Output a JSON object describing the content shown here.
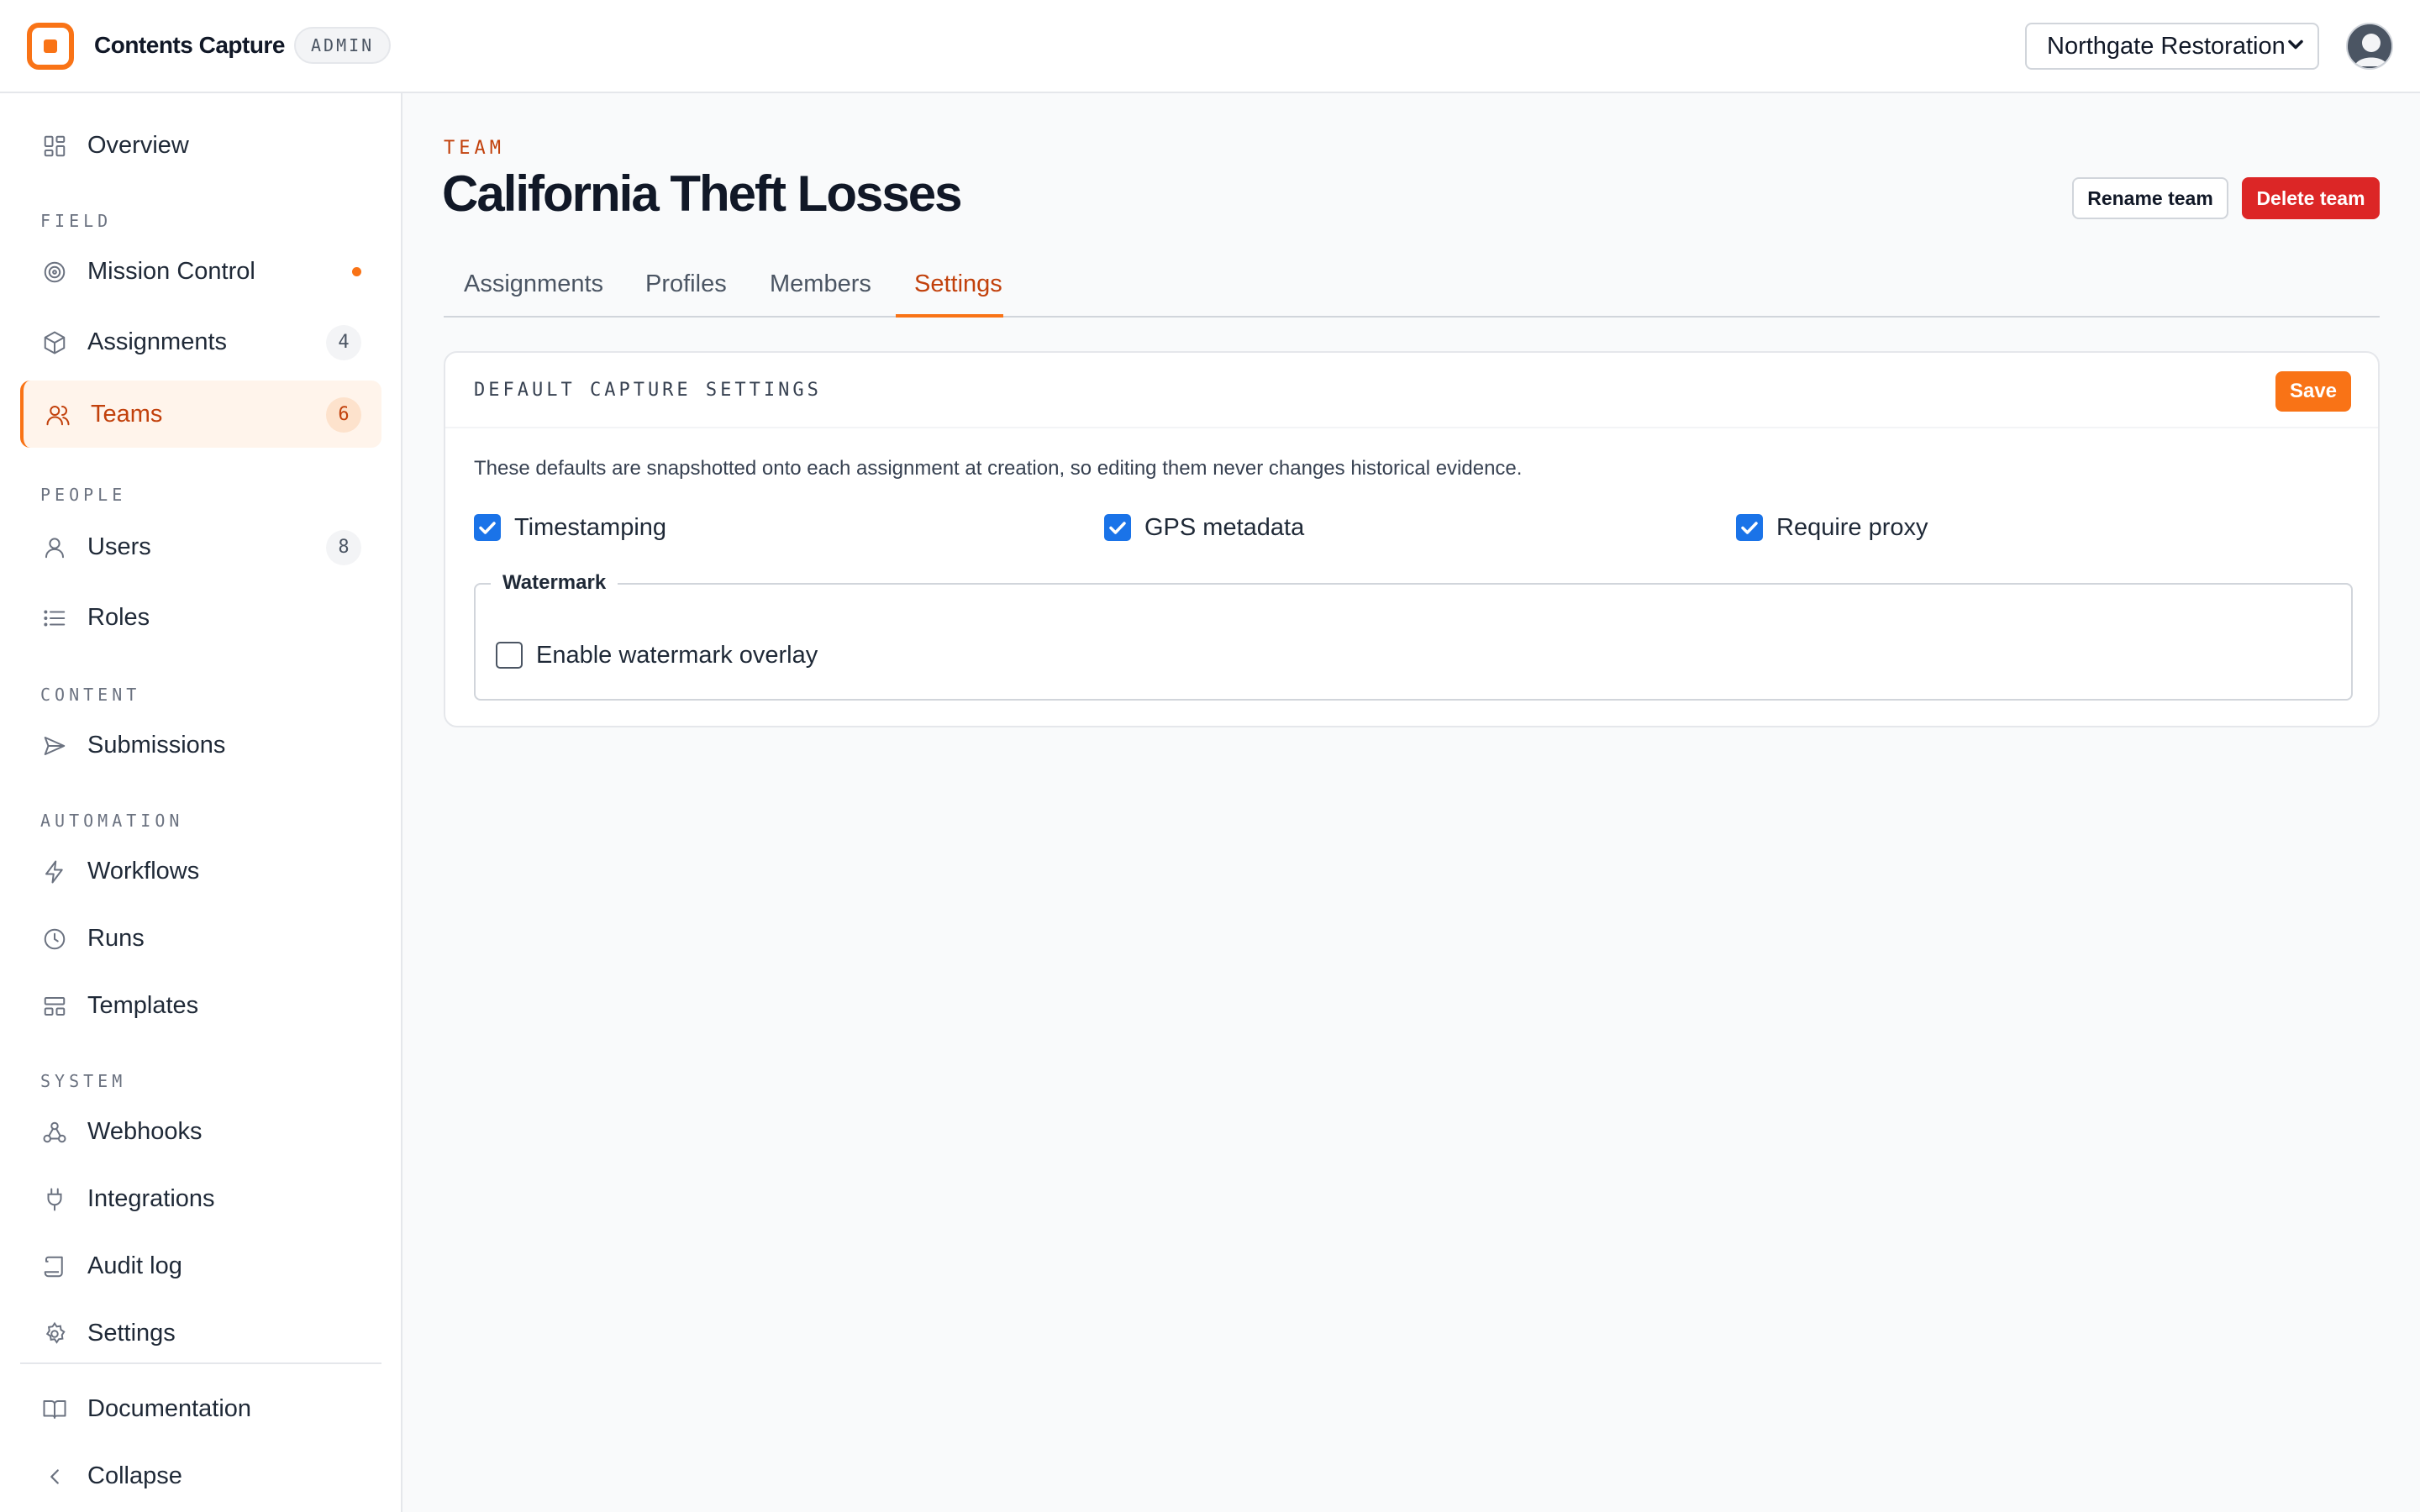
{
  "app": {
    "brand": "Contents Capture",
    "role_badge": "ADMIN",
    "org_selected": "Northgate Restoration"
  },
  "sidebar": {
    "overview": "Overview",
    "sections": {
      "field": "FIELD",
      "people": "PEOPLE",
      "content": "CONTENT",
      "automation": "AUTOMATION",
      "system": "SYSTEM"
    },
    "items": {
      "mission_control": "Mission Control",
      "assignments": "Assignments",
      "assignments_count": "4",
      "teams": "Teams",
      "teams_count": "6",
      "users": "Users",
      "users_count": "8",
      "roles": "Roles",
      "submissions": "Submissions",
      "workflows": "Workflows",
      "runs": "Runs",
      "templates": "Templates",
      "webhooks": "Webhooks",
      "integrations": "Integrations",
      "audit_log": "Audit log",
      "settings": "Settings",
      "documentation": "Documentation",
      "collapse": "Collapse"
    }
  },
  "header": {
    "eyebrow": "TEAM",
    "title": "California Theft Losses",
    "rename_label": "Rename team",
    "delete_label": "Delete team"
  },
  "tabs": {
    "assignments": "Assignments",
    "profiles": "Profiles",
    "members": "Members",
    "settings": "Settings",
    "active": "Settings"
  },
  "card": {
    "title": "DEFAULT CAPTURE SETTINGS",
    "save_label": "Save",
    "description": "These defaults are snapshotted onto each assignment at creation, so editing them never changes historical evidence.",
    "options": {
      "timestamping": "Timestamping",
      "gps": "GPS metadata",
      "proxy": "Require proxy"
    },
    "watermark": {
      "legend": "Watermark",
      "option": "Enable watermark overlay"
    }
  },
  "colors": {
    "accent": "#f97316",
    "danger": "#dc2626",
    "checkbox": "#1a73e8"
  }
}
